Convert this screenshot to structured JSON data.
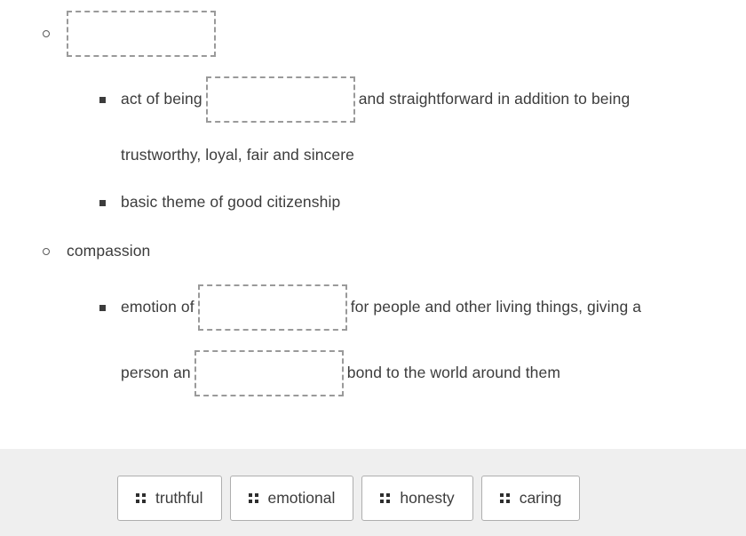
{
  "colors": {
    "text": "#3c3c3c",
    "dropzone_border": "#9a9a9a",
    "tray_background": "#efefef",
    "chip_border": "#aeaeae",
    "chip_background": "#ffffff"
  },
  "outline": {
    "items": [
      {
        "id": "honesty-heading",
        "marker": "circle",
        "level": 1,
        "segments": [
          {
            "type": "dropzone",
            "name": "dropzone-honesty",
            "value": "",
            "placeholder": ""
          }
        ]
      },
      {
        "id": "act-of-being",
        "marker": "square",
        "level": 2,
        "segments": [
          {
            "type": "text",
            "value": "act of being"
          },
          {
            "type": "dropzone",
            "name": "dropzone-truthful",
            "value": "",
            "placeholder": ""
          },
          {
            "type": "text",
            "value": "and straightforward in addition to being"
          }
        ]
      },
      {
        "id": "act-of-being-cont",
        "marker": "none",
        "level": 2,
        "segments": [
          {
            "type": "text",
            "value": "trustworthy, loyal, fair and sincere"
          }
        ]
      },
      {
        "id": "basic-theme",
        "marker": "square",
        "level": 2,
        "segments": [
          {
            "type": "text",
            "value": "basic theme of good citizenship"
          }
        ]
      },
      {
        "id": "compassion-heading",
        "marker": "circle",
        "level": 1,
        "segments": [
          {
            "type": "text",
            "value": "compassion"
          }
        ]
      },
      {
        "id": "emotion-of",
        "marker": "square",
        "level": 2,
        "segments": [
          {
            "type": "text",
            "value": "emotion of"
          },
          {
            "type": "dropzone",
            "name": "dropzone-caring",
            "value": "",
            "placeholder": ""
          },
          {
            "type": "text",
            "value": "for people and other living things, giving a"
          }
        ]
      },
      {
        "id": "emotion-of-cont",
        "marker": "none",
        "level": 2,
        "segments": [
          {
            "type": "text",
            "value": "person an"
          },
          {
            "type": "dropzone",
            "name": "dropzone-emotional",
            "value": "",
            "placeholder": ""
          },
          {
            "type": "text",
            "value": "bond to the world around them"
          }
        ]
      }
    ]
  },
  "tray": {
    "chips": [
      {
        "label": "truthful",
        "icon": "drag-handle-icon"
      },
      {
        "label": "emotional",
        "icon": "drag-handle-icon"
      },
      {
        "label": "honesty",
        "icon": "drag-handle-icon"
      },
      {
        "label": "caring",
        "icon": "drag-handle-icon"
      }
    ]
  }
}
